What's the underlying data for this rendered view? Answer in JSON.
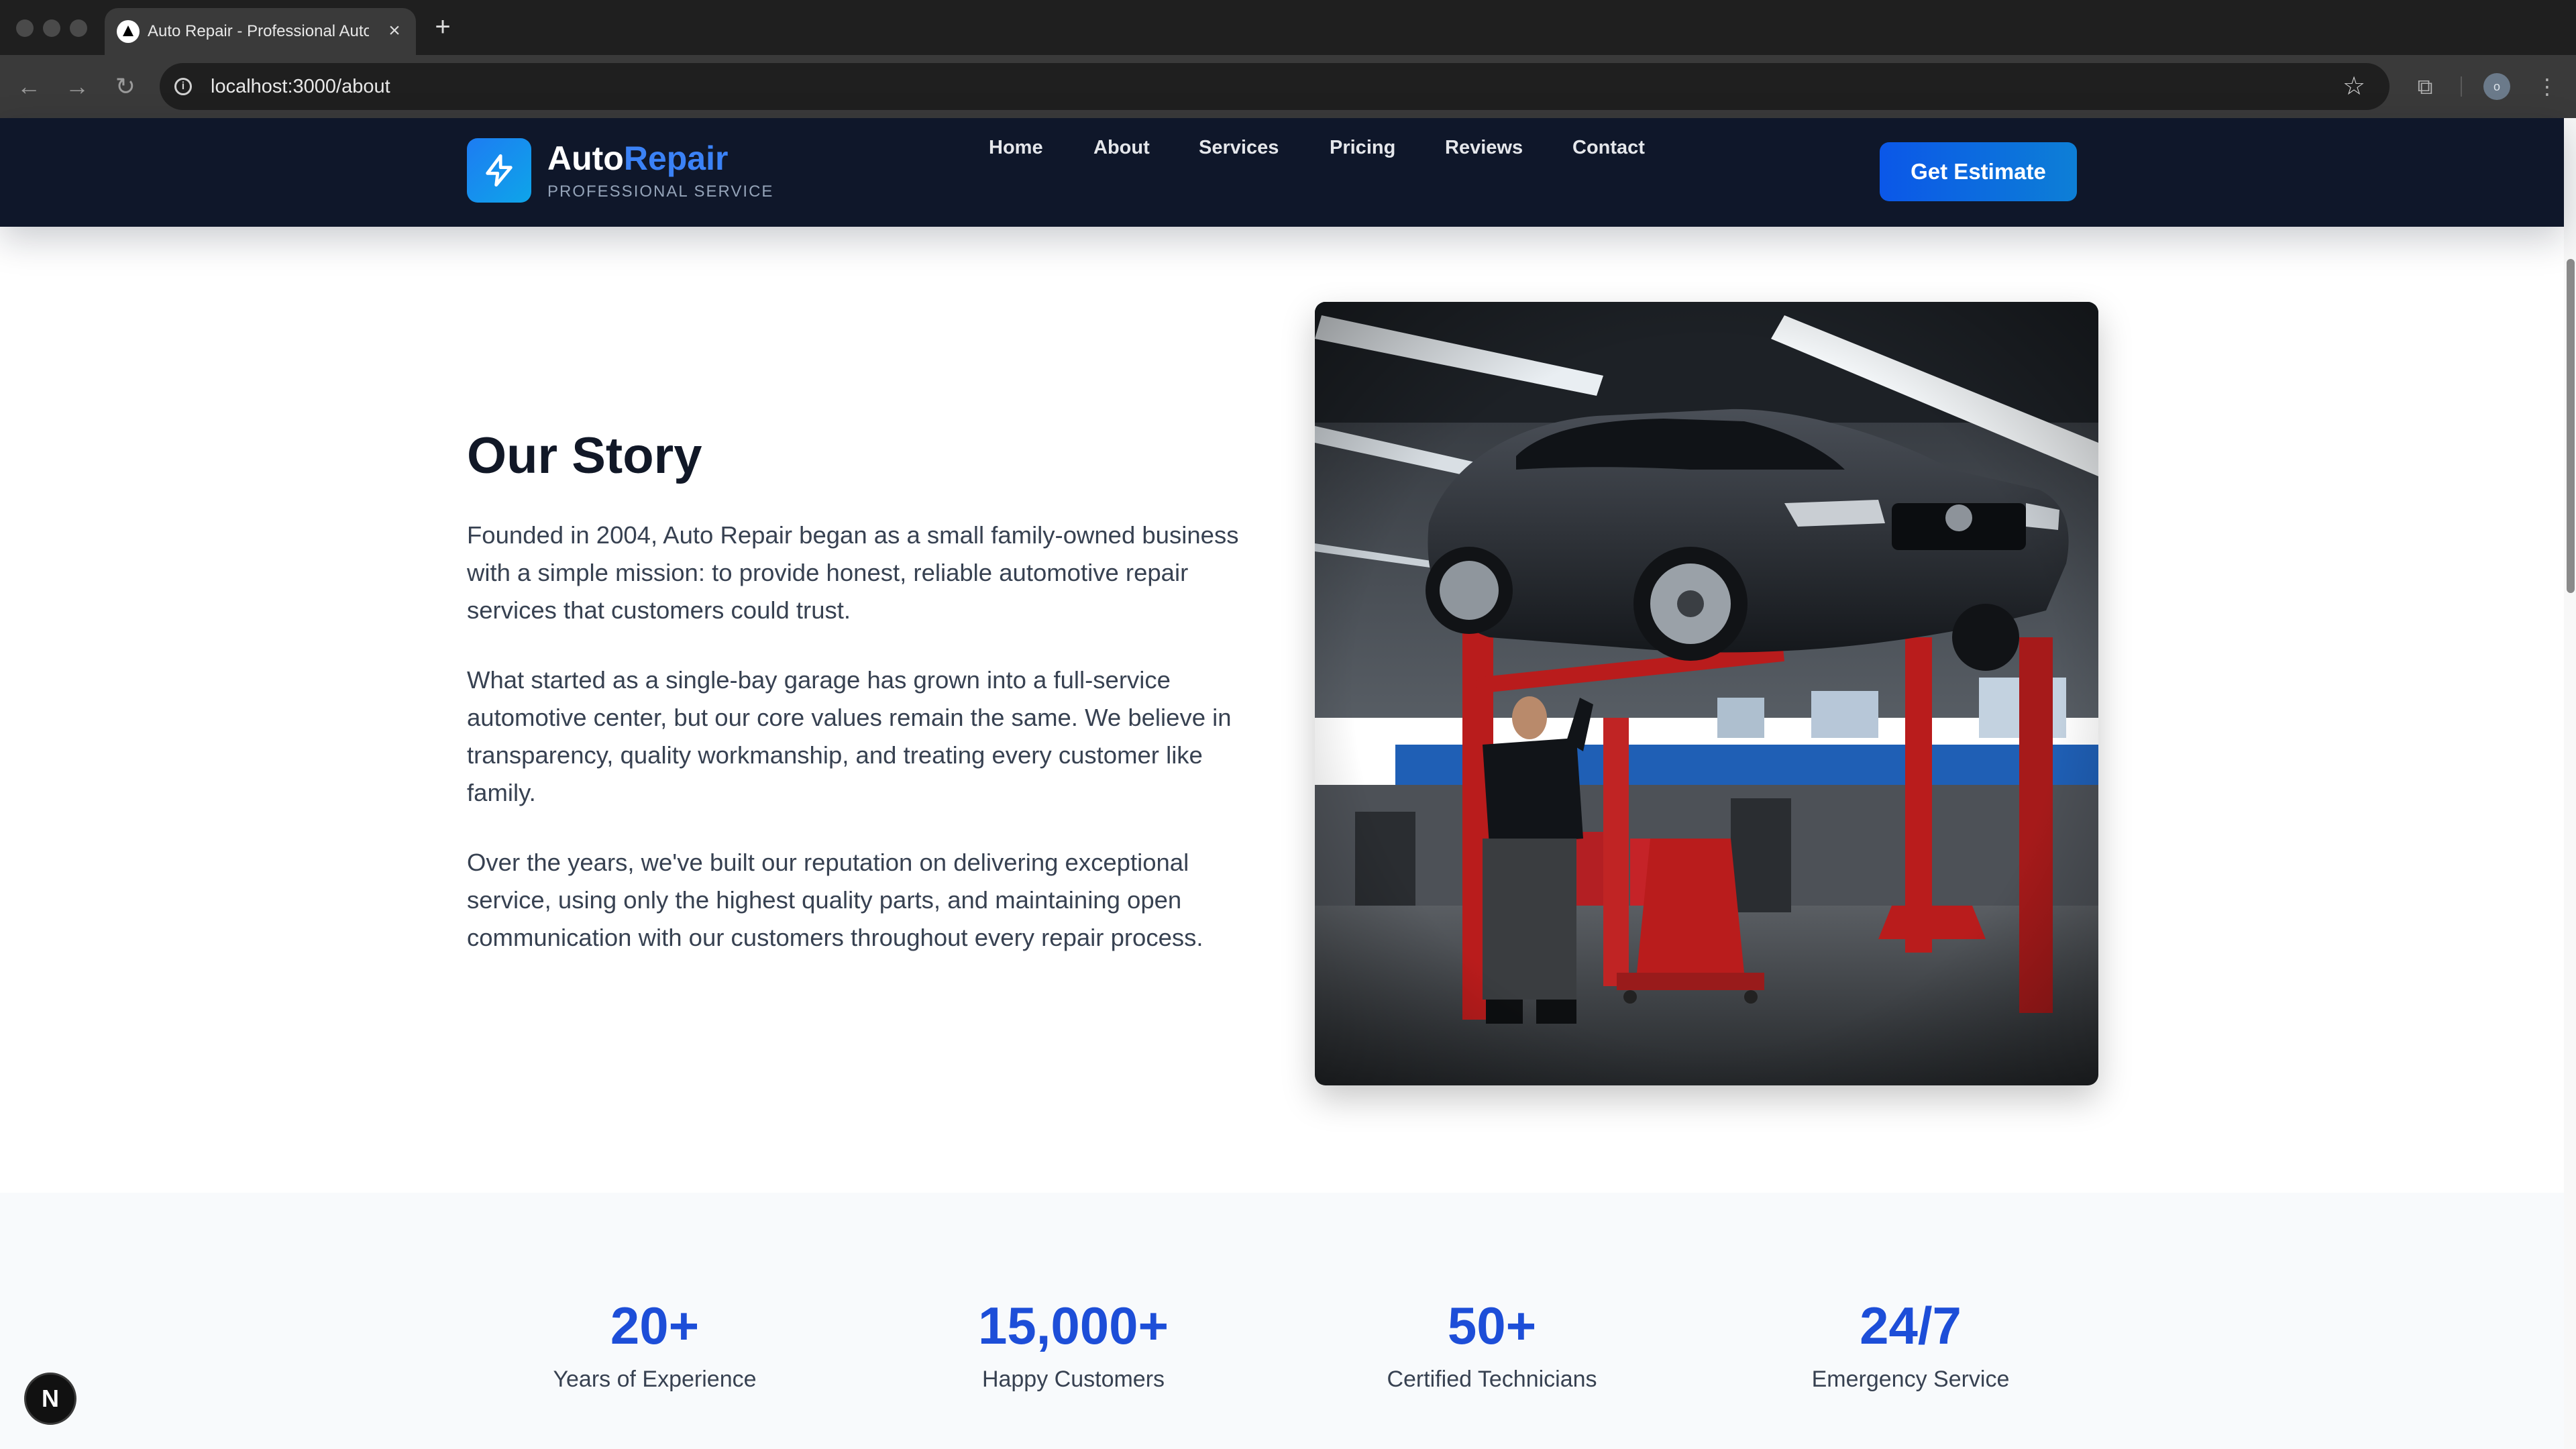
{
  "browser": {
    "tab_title": "Auto Repair - Professional Auto Repair Services",
    "url": "localhost:3000/about",
    "profile_initial": "o",
    "icons": [
      "back-icon",
      "forward-icon",
      "reload-icon",
      "info-icon",
      "star-icon",
      "tab-search-icon",
      "menu-icon",
      "close-icon",
      "plus-icon"
    ]
  },
  "header": {
    "brand_part1": "Auto",
    "brand_part2": "Repair",
    "tagline": "PROFESSIONAL SERVICE",
    "logo_icon": "lightning-bolt-icon",
    "nav": {
      "home": "Home",
      "about": "About",
      "services": "Services",
      "pricing": "Pricing",
      "reviews": "Reviews",
      "contact": "Contact"
    },
    "cta": "Get Estimate",
    "colors": {
      "header_bg": "#0f172a",
      "brand_accent": "#3b82f6",
      "cta_start": "#0b57e8",
      "cta_end": "#0d7fd6"
    }
  },
  "story": {
    "title": "Our Story",
    "paragraphs": {
      "p1": "Founded in 2004, Auto Repair began as a small family-owned business with a simple mission: to provide honest, reliable automotive repair services that customers could trust.",
      "p2": "What started as a single-bay garage has grown into a full-service automotive center, but our core values remain the same. We believe in transparency, quality workmanship, and treating every customer like family.",
      "p3": "Over the years, we've built our reputation on delivering exceptional service, using only the highest quality parts, and maintaining open communication with our customers throughout every repair process."
    }
  },
  "stats": {
    "s1": {
      "value": "20+",
      "label": "Years of Experience"
    },
    "s2": {
      "value": "15,000+",
      "label": "Happy Customers"
    },
    "s3": {
      "value": "50+",
      "label": "Certified Technicians"
    },
    "s4": {
      "value": "24/7",
      "label": "Emergency Service"
    },
    "accent": "#1d4ed8"
  },
  "dev_badge": "N"
}
